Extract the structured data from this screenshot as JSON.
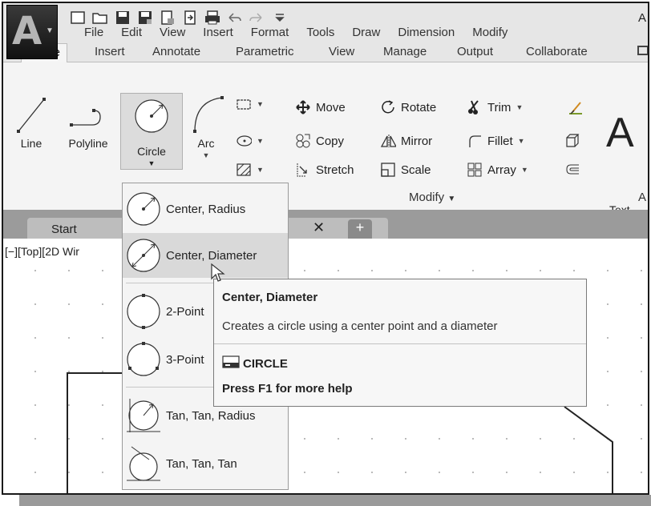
{
  "app": {
    "letter": "A",
    "title_fragment": "A"
  },
  "menubar": [
    "File",
    "Edit",
    "View",
    "Insert",
    "Format",
    "Tools",
    "Draw",
    "Dimension",
    "Modify"
  ],
  "ribbon_tabs": [
    "Home",
    "Insert",
    "Annotate",
    "Parametric",
    "View",
    "Manage",
    "Output",
    "Collaborate"
  ],
  "draw_panel": {
    "line": "Line",
    "polyline": "Polyline",
    "circle": "Circle",
    "arc": "Arc"
  },
  "modify_panel": {
    "move": "Move",
    "rotate": "Rotate",
    "trim": "Trim",
    "copy": "Copy",
    "mirror": "Mirror",
    "fillet": "Fillet",
    "stretch": "Stretch",
    "scale": "Scale",
    "array": "Array",
    "title": "Modify"
  },
  "annotation_panel": {
    "text": "Text",
    "title_fragment": "A"
  },
  "file_tabs": {
    "start": "Start",
    "close": "✕",
    "new": "+"
  },
  "viewport_label": "[−][Top][2D Wir",
  "circle_menu": [
    {
      "label": "Center, Radius"
    },
    {
      "label": "Center, Diameter"
    },
    {
      "label": "2-Point"
    },
    {
      "label": "3-Point"
    },
    {
      "label": "Tan, Tan, Radius"
    },
    {
      "label": "Tan, Tan, Tan"
    }
  ],
  "tooltip": {
    "title": "Center, Diameter",
    "description": "Creates a circle using a center point and a diameter",
    "command": "CIRCLE",
    "help": "Press F1 for more help"
  }
}
